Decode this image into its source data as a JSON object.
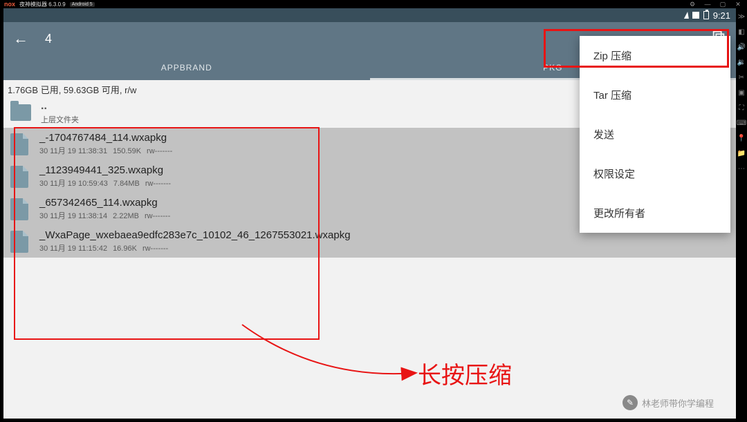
{
  "window": {
    "logo": "nox",
    "title": "夜神模拟器 6.3.0.9",
    "badge": "Android 5"
  },
  "statusbar": {
    "time": "9:21"
  },
  "appbar": {
    "title": "4"
  },
  "tabs": {
    "left": "APPBRAND",
    "right": "PKG"
  },
  "storage": "1.76GB 已用, 59.63GB 可用, r/w",
  "parent": {
    "dots": "..",
    "label": "上层文件夹"
  },
  "files": [
    {
      "name": "_-1704767484_114.wxapkg",
      "date": "30 11月 19 11:38:31",
      "size": "150.59K",
      "perm": "rw-------"
    },
    {
      "name": "_1123949441_325.wxapkg",
      "date": "30 11月 19 10:59:43",
      "size": "7.84MB",
      "perm": "rw-------"
    },
    {
      "name": "_657342465_114.wxapkg",
      "date": "30 11月 19 11:38:14",
      "size": "2.22MB",
      "perm": "rw-------"
    },
    {
      "name": "_WxaPage_wxebaea9edfc283e7c_10102_46_1267553021.wxapkg",
      "date": "30 11月 19 11:15:42",
      "size": "16.96K",
      "perm": "rw-------"
    }
  ],
  "menu": {
    "zip": "Zip 压缩",
    "tar": "Tar 压缩",
    "send": "发送",
    "perm": "权限设定",
    "owner": "更改所有者"
  },
  "annotation": "长按压缩",
  "watermark": "林老师带你学编程"
}
